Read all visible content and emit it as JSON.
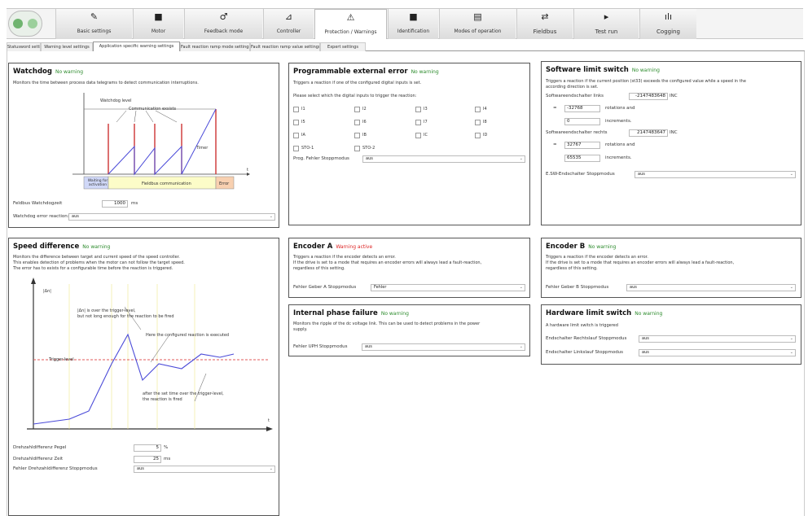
{
  "toolbar": {
    "tabs": [
      {
        "label": "Basic settings",
        "icon": "✎"
      },
      {
        "label": "Motor",
        "icon": "■"
      },
      {
        "label": "Feedback mode",
        "icon": "♂"
      },
      {
        "label": "Controller",
        "icon": "⊿"
      },
      {
        "label": "Protection / Warnings",
        "icon": "⚠"
      },
      {
        "label": "Identification",
        "icon": "■"
      },
      {
        "label": "Modes of operation",
        "icon": "▤"
      },
      {
        "label": "Fieldbus",
        "icon": "⇄"
      },
      {
        "label": "Test run",
        "icon": "▸"
      },
      {
        "label": "Cogging",
        "icon": "ılı"
      }
    ]
  },
  "subtabs": [
    "Statusword settings",
    "Warning level settings",
    "Application specific warning settings",
    "Fault reaction ramp mode settings",
    "Fault reaction ramp value settings",
    "Expert settings"
  ],
  "watchdog": {
    "title": "Watchdog",
    "status": "No warning",
    "desc": "Monitors the time between process data telegrams to detect communication interruptions.",
    "diagram": {
      "level": "Watchdog level",
      "comm": "Communication exsists",
      "timer": "Timer",
      "t": "t",
      "waiting": "Waiting for activation",
      "fieldbus": "Fieldbus communication",
      "error": "Error"
    },
    "field_label": "Feldbus Watchdogzeit",
    "field_value": "1000",
    "field_unit": "ms",
    "reaction_label": "Watchdog error reaction:",
    "reaction_value": "aus"
  },
  "prog_ext": {
    "title": "Programmable external error",
    "status": "No warning",
    "desc": "Triggers a reaction if one of the configured digital inputs is set.",
    "select_text": "Please select which the digital inputs to trigger the reaction:",
    "inputs": [
      "I1",
      "I2",
      "I3",
      "I4",
      "I5",
      "I6",
      "I7",
      "I8",
      "IA",
      "IB",
      "IC",
      "ID",
      "STO-1",
      "STO-2"
    ],
    "mode_label": "Prog. Fehler Stoppmodus",
    "mode_value": "aus"
  },
  "swlimit": {
    "title": "Software limit switch",
    "status": "No warning",
    "desc1": "Triggers a reaction if the current position (st33) exceeds the configured value while a speed in the",
    "desc2": "according direction is set.",
    "links_label": "Softwareendschalter links",
    "links_value": "-2147483648",
    "links_unit": "INC",
    "eq": "=",
    "l_rot": "-32768",
    "rot_label": "rotations and",
    "l_inc": "0",
    "inc_label": "increments.",
    "rechts_label": "Softwareendschalter rechts",
    "rechts_value": "2147483647",
    "rechts_unit": "INC",
    "r_rot": "32767",
    "r_inc": "65535",
    "mode_label": "E.SW-Endschalter Stoppmodus",
    "mode_value": "aus"
  },
  "speed": {
    "title": "Speed difference",
    "status": "No warning",
    "desc1": "Monitors the difference between target and current speed of the speed controller.",
    "desc2": "This enables detection of problems when the motor can not follow the target speed.",
    "desc3": "The error has to exists for a configurable time before the reaction is triggered.",
    "diagram": {
      "yaxis": "|Δn|",
      "ann1": "|Δn| is over the trigger-level,",
      "ann1b": "but not long enough for the reaction to be fired",
      "ann2": "Here the configured reaction is executed",
      "trigger": "Trigger-level",
      "ann3": "after the set time over the trigger-level,",
      "ann3b": "the reaction is fired",
      "t": "t"
    },
    "pegel_label": "Drehzahldifferenz Pegel",
    "pegel_value": "5",
    "pegel_unit": "%",
    "zeit_label": "Drehzahldifferenz Zeit",
    "zeit_value": "25",
    "zeit_unit": "ms",
    "mode_label": "Fehler Drehzahldifferenz Stoppmodus",
    "mode_value": "aus"
  },
  "encA": {
    "title": "Encoder A",
    "status": "Warning active",
    "desc1": "Triggers a reaction if the encoder detects an error.",
    "desc2": "If the drive is set to a mode that requires an encoder errors will always lead a fault-reaction,",
    "desc3": "regardless of this setting.",
    "mode_label": "Fehler Geber A Stoppmodus",
    "mode_value": "Fehler"
  },
  "encB": {
    "title": "Encoder B",
    "status": "No warning",
    "desc1": "Triggers a reaction if the encoder detects an error.",
    "desc2": "If the drive is set to a mode that requires an encoder errors will always lead a fault-reaction,",
    "desc3": "regardless of this setting.",
    "mode_label": "Fehler Geber B Stoppmodus",
    "mode_value": "aus"
  },
  "phase": {
    "title": "Internal phase failure",
    "status": "No warning",
    "desc1": "Monitors the ripple of the dc voltage link. This can be used to detect problems in the power",
    "desc2": "supply.",
    "mode_label": "Fehler UPH Stoppmodus",
    "mode_value": "aus"
  },
  "hwlimit": {
    "title": "Hardware limit switch",
    "status": "No warning",
    "desc": "A hardware limit switch is triggered",
    "r_label": "Endschalter Rechtslauf Stoppmodus",
    "r_value": "aus",
    "l_label": "Endschalter Linkslauf Stoppmodus",
    "l_value": "aus"
  },
  "colors": {
    "ok": "#2a8a2a",
    "warn": "#dd2222",
    "signal": "#4a4ad8",
    "pulse": "#cc2222"
  }
}
